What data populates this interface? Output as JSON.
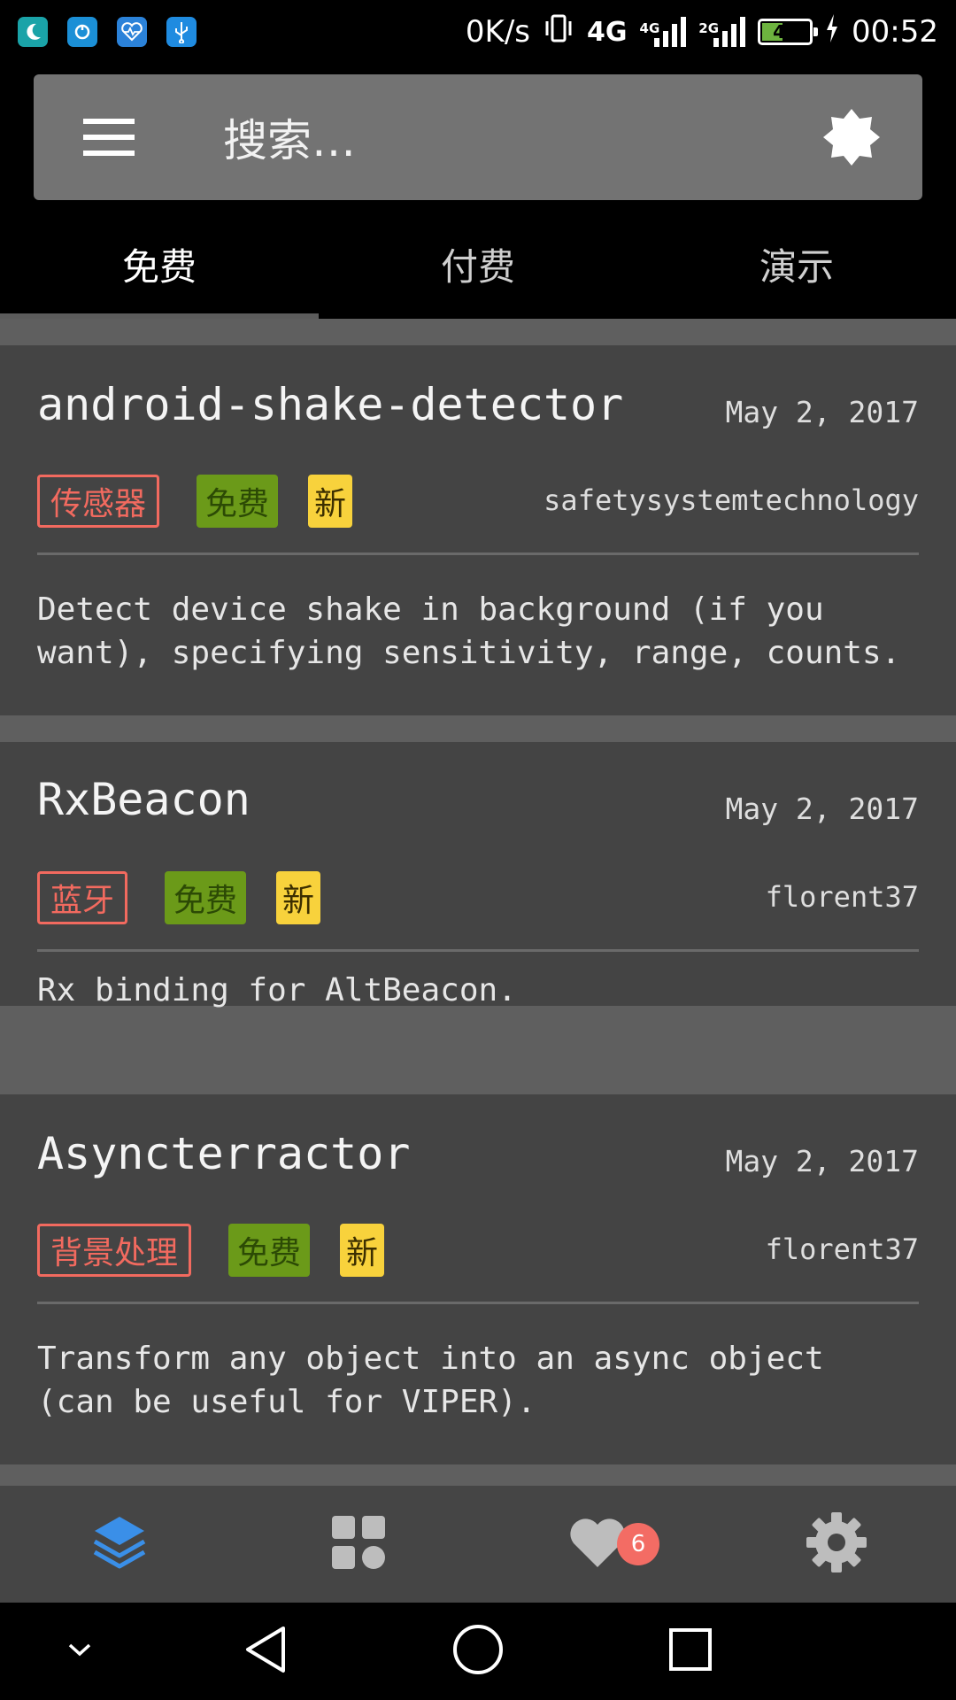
{
  "status_bar": {
    "net_speed": "0K/s",
    "network_4g": "4G",
    "network_4g_small": "4G",
    "network_2g": "2G",
    "battery": "41",
    "time": "00:52",
    "notification_icons": [
      "moon-app-icon",
      "sync-app-icon",
      "health-app-icon",
      "usb-icon"
    ]
  },
  "search": {
    "placeholder": "搜索…"
  },
  "tabs": [
    {
      "label": "免费",
      "active": true
    },
    {
      "label": "付费",
      "active": false
    },
    {
      "label": "演示",
      "active": false
    }
  ],
  "cards": [
    {
      "title": "android-shake-detector",
      "date": "May 2, 2017",
      "category": "传感器",
      "free_tag": "免费",
      "new_tag": "新",
      "author": "safetysystemtechnology",
      "description": "Detect device shake in background (if you want), specifying sensitivity, range, counts."
    },
    {
      "title": "RxBeacon",
      "date": "May 2, 2017",
      "category": "蓝牙",
      "free_tag": "免费",
      "new_tag": "新",
      "author": "florent37",
      "description": "Rx binding for AltBeacon."
    },
    {
      "title": "Asyncterractor",
      "date": "May 2, 2017",
      "category": "背景处理",
      "free_tag": "免费",
      "new_tag": "新",
      "author": "florent37",
      "description": "Transform any object into an async object (can be useful for VIPER)."
    }
  ],
  "bottom_nav": {
    "items": [
      "layers-icon",
      "grid-icon",
      "heart-icon",
      "gear-icon"
    ],
    "favorites_badge": "6"
  },
  "colors": {
    "accent": "#3a8fe8",
    "category_tag": "#f26a5f",
    "free_tag": "#6b9a19",
    "new_tag": "#f8d23c",
    "card_bg": "#444444",
    "badge": "#f36c64"
  }
}
